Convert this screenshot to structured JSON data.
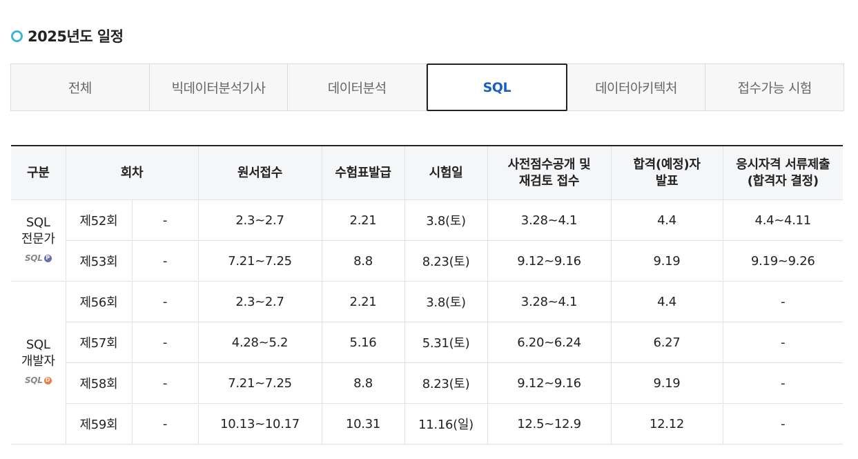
{
  "page_title": "2025년도 일정",
  "tabs": [
    {
      "label": "전체",
      "active": false
    },
    {
      "label": "빅데이터분석기사",
      "active": false
    },
    {
      "label": "데이터분석",
      "active": false
    },
    {
      "label": "SQL",
      "active": true
    },
    {
      "label": "데이터아키텍처",
      "active": false
    },
    {
      "label": "접수가능 시험",
      "active": false
    }
  ],
  "table": {
    "headers": {
      "category": "구분",
      "round": "회차",
      "application": "원서접수",
      "ticket": "수험표발급",
      "exam_date": "시험일",
      "prelim_line1": "사전점수공개 및",
      "prelim_line2": "재검토 접수",
      "result_line1": "합격(예정)자",
      "result_line2": "발표",
      "docs_line1": "응시자격 서류제출",
      "docs_line2": "(합격자 결정)"
    },
    "groups": [
      {
        "name_line1": "SQL",
        "name_line2": "전문가",
        "logo_text": "SQL",
        "logo_badge": "P",
        "rows": [
          {
            "round": "제52회",
            "extra": "-",
            "application": "2.3~2.7",
            "ticket": "2.21",
            "exam_date": "3.8(토)",
            "prelim": "3.28~4.1",
            "result": "4.4",
            "docs": "4.4~4.11"
          },
          {
            "round": "제53회",
            "extra": "-",
            "application": "7.21~7.25",
            "ticket": "8.8",
            "exam_date": "8.23(토)",
            "prelim": "9.12~9.16",
            "result": "9.19",
            "docs": "9.19~9.26"
          }
        ]
      },
      {
        "name_line1": "SQL",
        "name_line2": "개발자",
        "logo_text": "SQL",
        "logo_badge": "D",
        "rows": [
          {
            "round": "제56회",
            "extra": "-",
            "application": "2.3~2.7",
            "ticket": "2.21",
            "exam_date": "3.8(토)",
            "prelim": "3.28~4.1",
            "result": "4.4",
            "docs": "-"
          },
          {
            "round": "제57회",
            "extra": "-",
            "application": "4.28~5.2",
            "ticket": "5.16",
            "exam_date": "5.31(토)",
            "prelim": "6.20~6.24",
            "result": "6.27",
            "docs": "-"
          },
          {
            "round": "제58회",
            "extra": "-",
            "application": "7.21~7.25",
            "ticket": "8.8",
            "exam_date": "8.23(토)",
            "prelim": "9.12~9.16",
            "result": "9.19",
            "docs": "-"
          },
          {
            "round": "제59회",
            "extra": "-",
            "application": "10.13~10.17",
            "ticket": "10.31",
            "exam_date": "11.16(일)",
            "prelim": "12.5~12.9",
            "result": "12.12",
            "docs": "-"
          }
        ]
      }
    ]
  },
  "colors": {
    "accent_dot": "#3fb6d6",
    "active_tab_text": "#1a5fbf",
    "badge_professional": "#6a6fb0",
    "badge_developer": "#f07b3f"
  }
}
